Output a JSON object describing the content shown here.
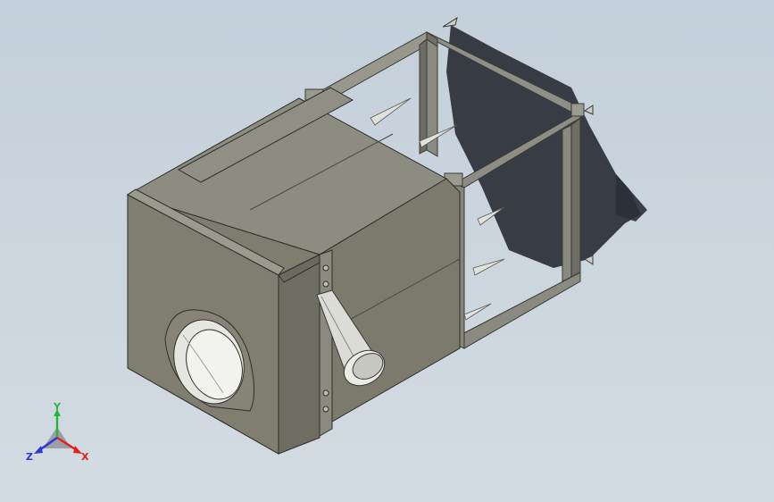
{
  "viewport": {
    "view": "isometric",
    "background_top": "#c3cfda",
    "background_bottom": "#d3dbe2"
  },
  "model": {
    "body_color": "#7f7f72",
    "front_face_color": "#7d7c6e",
    "side_face_color": "#6f6e62",
    "top_face_color": "#8a8a7e",
    "frame_color": "#8b8b80",
    "cone_color": "#d9d9d4",
    "shadow_color": "#2b3038"
  },
  "triad": {
    "x_label": "X",
    "y_label": "Y",
    "z_label": "Z",
    "x_color": "#e0211c",
    "y_color": "#28b53b",
    "z_color": "#2b39d0"
  }
}
